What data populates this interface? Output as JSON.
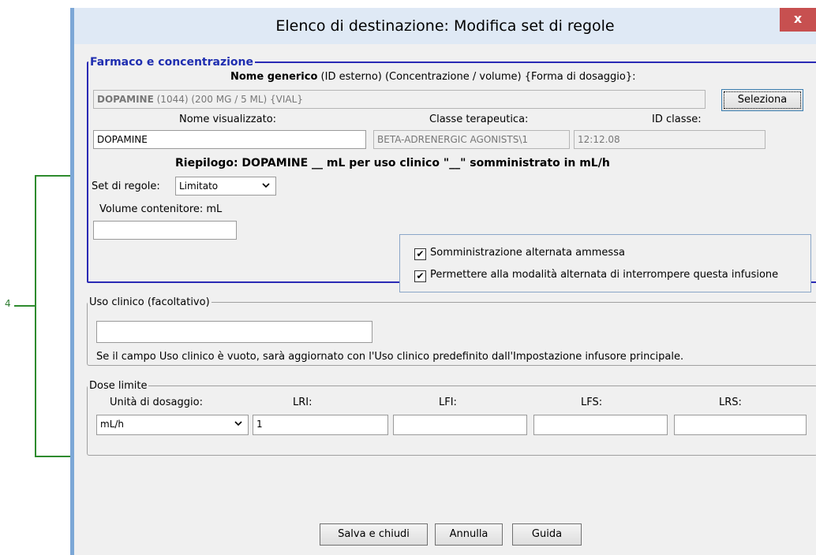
{
  "callout": {
    "number": "4"
  },
  "window": {
    "title": "Elenco di destinazione: Modifica set di regole",
    "close_glyph": "x"
  },
  "drug": {
    "legend": "Farmaco e concentrazione",
    "generic_header_bold": "Nome generico",
    "generic_header_rest": "(ID esterno) (Concentrazione / volume) {Forma di dosaggio}:",
    "generic_bold": "DOPAMINE",
    "generic_rest": "(1044) (200 MG / 5 ML) {VIAL}",
    "select_button": "Seleziona",
    "display_name_label": "Nome visualizzato:",
    "display_name_value": "DOPAMINE",
    "therapeutic_class_label": "Classe terapeutica:",
    "therapeutic_class_value": "BETA-ADRENERGIC AGONISTS\\1",
    "class_id_label": "ID classe:",
    "class_id_value": "12:12.08",
    "summary": "Riepilogo: DOPAMINE __ mL per uso clinico \"__\" somministrato in mL/h",
    "rule_set_label": "Set di regole:",
    "rule_set_value": "Limitato",
    "container_volume_label": "Volume contenitore: mL",
    "container_volume_value": "",
    "check_alternate_allowed": "Somministrazione alternata ammessa",
    "check_alternate_interrupt": "Permettere alla modalità alternata di interrompere questa infusione"
  },
  "clinical": {
    "legend": "Uso clinico (facoltativo)",
    "value": "",
    "note": "Se il campo Uso clinico è vuoto, sarà aggiornato con l'Uso clinico predefinito dall'Impostazione infusore principale."
  },
  "dose": {
    "legend": "Dose limite",
    "unit_label": "Unità di dosaggio:",
    "unit_value": "mL/h",
    "lri_label": "LRI:",
    "lri_value": "1",
    "lfi_label": "LFI:",
    "lfi_value": "",
    "lfs_label": "LFS:",
    "lfs_value": "",
    "lrs_label": "LRS:",
    "lrs_value": ""
  },
  "buttons": {
    "save_close": "Salva e chiudi",
    "cancel": "Annulla",
    "help": "Guida"
  },
  "icons": {
    "checkbox_mark": "✔",
    "dropdown": "chevron-down-icon"
  }
}
